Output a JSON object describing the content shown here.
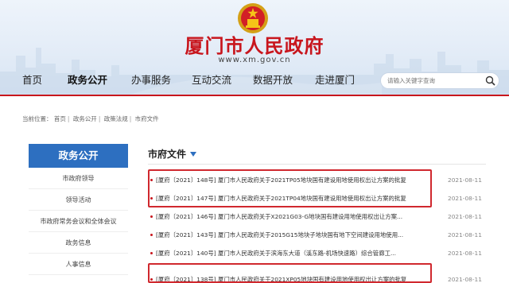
{
  "header": {
    "site_title": "厦门市人民政府",
    "site_url": "www.xm.gov.cn",
    "accent_color": "#c8161d",
    "emblem_icon": "national-emblem-icon"
  },
  "nav": {
    "items": [
      {
        "label": "首页",
        "active": false
      },
      {
        "label": "政务公开",
        "active": true
      },
      {
        "label": "办事服务",
        "active": false
      },
      {
        "label": "互动交流",
        "active": false
      },
      {
        "label": "数据开放",
        "active": false
      },
      {
        "label": "走进厦门",
        "active": false
      }
    ],
    "search_placeholder": "请输入关键字查询",
    "search_icon": "search-icon"
  },
  "breadcrumb": {
    "prefix": "当前位置：",
    "items": [
      "首页",
      "政务公开",
      "政策法规",
      "市府文件"
    ]
  },
  "sidebar": {
    "heading": "政务公开",
    "heading_color": "#2d6fc0",
    "items": [
      "市政府领导",
      "领导活动",
      "市政府常务会议和全体会议",
      "政务信息",
      "人事信息"
    ]
  },
  "main": {
    "section_title": "市府文件",
    "news": [
      {
        "title": "[厦府〔2021〕148号] 厦门市人民政府关于2021TP05地块国有建设用地使用权出让方案的批复",
        "date": "2021-08-11",
        "highlighted": true
      },
      {
        "title": "[厦府〔2021〕147号] 厦门市人民政府关于2021TP04地块国有建设用地使用权出让方案的批复",
        "date": "2021-08-11",
        "highlighted": true
      },
      {
        "title": "[厦府〔2021〕146号] 厦门市人民政府关于X2021G03-G地块国有建设用地使用权出让方案...",
        "date": "2021-08-11",
        "highlighted": false
      },
      {
        "title": "[厦府〔2021〕143号] 厦门市人民政府关于2015G15地块子地块国有地下空间建设用地使用...",
        "date": "2021-08-11",
        "highlighted": false
      },
      {
        "title": "[厦府〔2021〕140号] 厦门市人民政府关于滨海东大道（溪东路-机场快速路）综合管廊工...",
        "date": "2021-08-11",
        "highlighted": false
      },
      {
        "title": "[厦府〔2021〕138号] 厦门市人民政府关于2021XP05地块国有建设用地使用权出让方案的批复",
        "date": "2021-08-11",
        "highlighted": true
      }
    ]
  }
}
